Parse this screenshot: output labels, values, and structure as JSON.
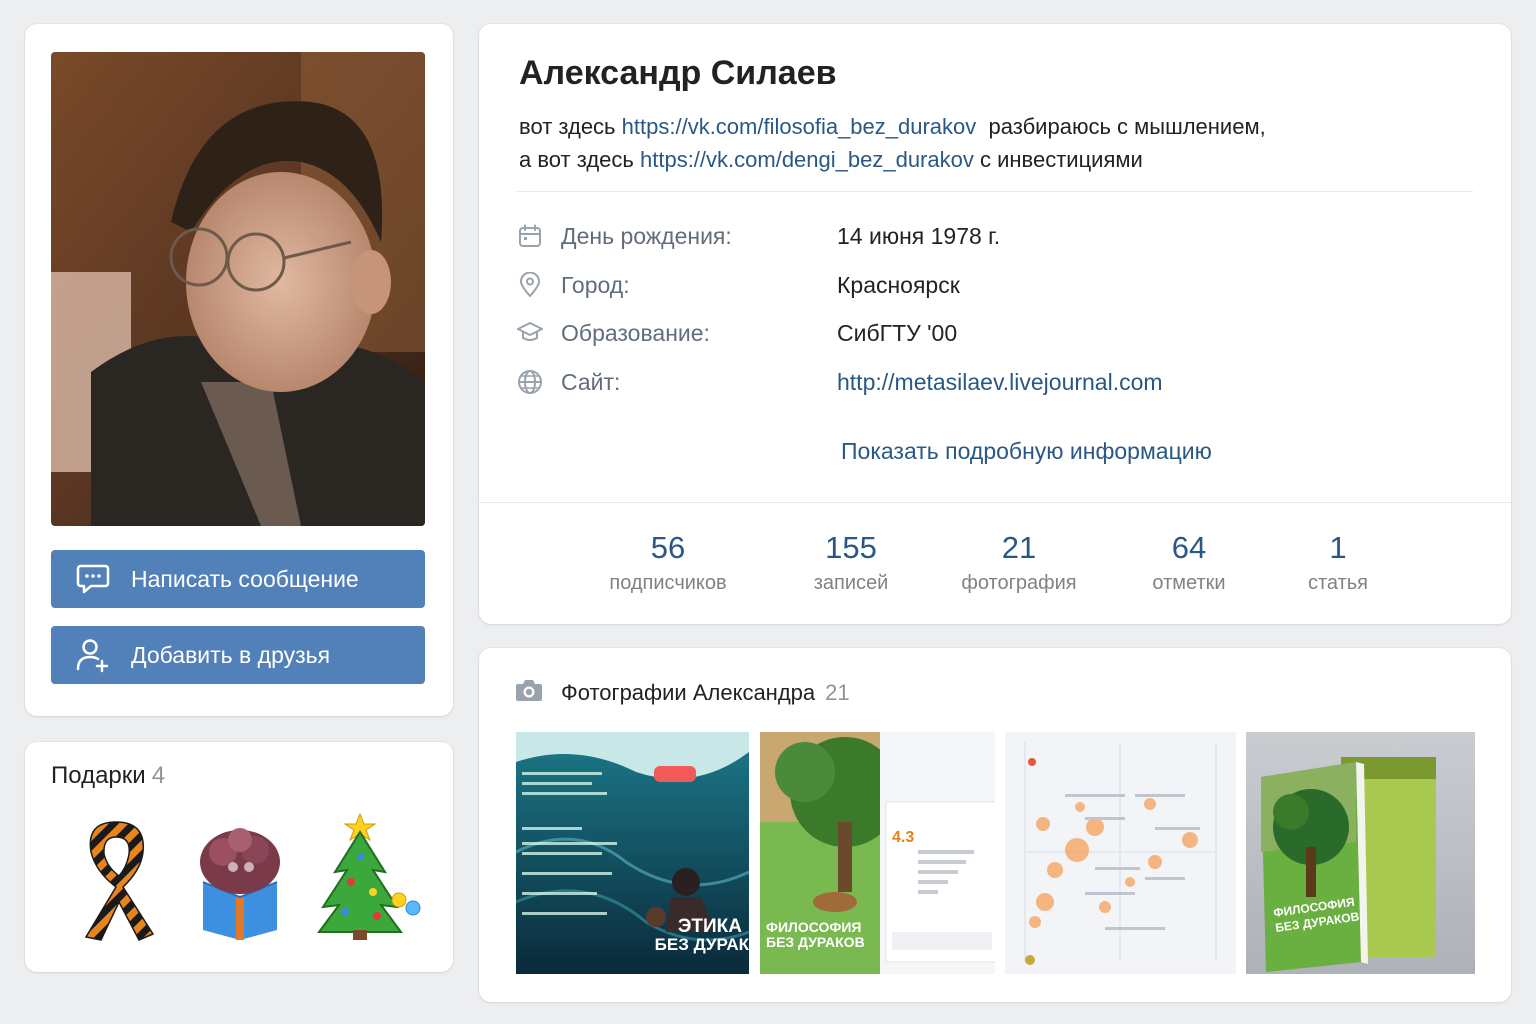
{
  "profile": {
    "name": "Александр Силаев",
    "status": {
      "line1_pre": "вот здесь",
      "line1_link": "https://vk.com/filosofia_bez_durakov",
      "line1_post": "разбираюсь с мышлением,",
      "line2_pre": "а вот здесь",
      "line2_link": "https://vk.com/dengi_bez_durakov",
      "line2_post": "с инвестициями"
    },
    "info": [
      {
        "label": "День рождения:",
        "value": "14 июня 1978 г.",
        "icon": "calendar-icon"
      },
      {
        "label": "Город:",
        "value": "Красноярск",
        "icon": "location-pin-icon"
      },
      {
        "label": "Образование:",
        "value": "СибГТУ '00",
        "icon": "graduation-cap-icon"
      },
      {
        "label": "Сайт:",
        "value": "http://metasilaev.livejournal.com",
        "icon": "globe-icon"
      }
    ],
    "show_more": "Показать подробную информацию"
  },
  "counters": [
    {
      "num": "56",
      "label": "подписчиков"
    },
    {
      "num": "155",
      "label": "записей"
    },
    {
      "num": "21",
      "label": "фотография"
    },
    {
      "num": "64",
      "label": "отметки"
    },
    {
      "num": "1",
      "label": "статья"
    }
  ],
  "actions": {
    "message": "Написать сообщение",
    "add_friend": "Добавить в друзья"
  },
  "gifts": {
    "title": "Подарки",
    "count": "4",
    "items": [
      "ribbon-icon",
      "gift-box-icon",
      "christmas-tree-icon"
    ]
  },
  "photos": {
    "title": "Фотографии Александра",
    "count": "21",
    "thumbs": [
      {
        "caption_a": "ЭТИКА",
        "caption_b": "БЕЗ ДУРАК"
      },
      {
        "caption_a": "ФИЛОСОФИЯ",
        "caption_b": "БЕЗ ДУРАКОВ",
        "rating": "4.3"
      },
      {
        "caption_a": "",
        "caption_b": ""
      },
      {
        "caption_a": "ФИЛОСОФИЯ",
        "caption_b": "БЕЗ ДУРАКОВ"
      }
    ]
  },
  "colors": {
    "accent": "#5181b8",
    "link": "#2a5885",
    "background": "#edeef0"
  }
}
